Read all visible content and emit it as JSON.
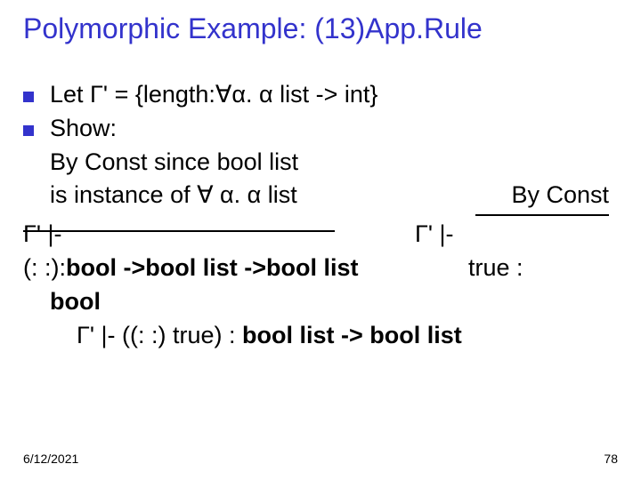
{
  "title": "Polymorphic Example: (13)App.Rule",
  "bullets": {
    "b1": "Let Γ' = {length:∀α. α list -> int}",
    "b2": "Show:"
  },
  "lines": {
    "l1": "By Const since bool list",
    "l2a": "is instance of ∀ α. α list",
    "l2b": "By Const",
    "l3a": "Γ' |-",
    "l3b": "Γ' |-",
    "l4a_pre": "(: :):",
    "l4a_bold": "bool ->bool list ->bool list",
    "l4b": "true :",
    "l5": "bool",
    "l6_pre": "Γ' |- ((: :) true) : ",
    "l6_bold": "bool list -> bool list"
  },
  "footer": {
    "date": "6/12/2021",
    "page": "78"
  }
}
